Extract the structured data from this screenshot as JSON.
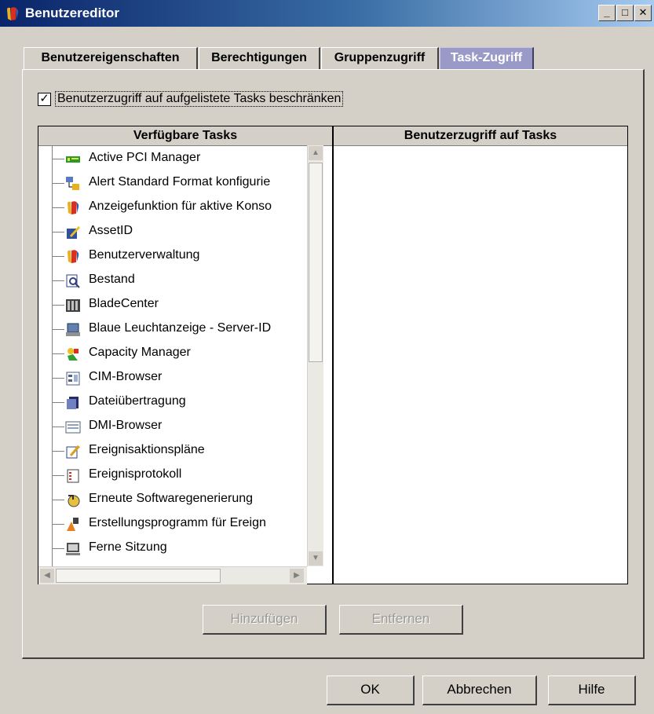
{
  "window": {
    "title": "Benutzereditor",
    "controls": {
      "minimize": "_",
      "maximize": "□",
      "close": "✕"
    }
  },
  "tabs": [
    {
      "label": "Benutzereigenschaften",
      "active": false
    },
    {
      "label": "Berechtigungen",
      "active": false
    },
    {
      "label": "Gruppenzugriff",
      "active": false
    },
    {
      "label": "Task-Zugriff",
      "active": true
    }
  ],
  "restrict": {
    "label": "Benutzerzugriff auf aufgelistete Tasks beschränken",
    "checked": true,
    "mark": "✓"
  },
  "available": {
    "header": "Verfügbare Tasks",
    "items": [
      {
        "label": "Active PCI Manager",
        "icon": "pci-card-icon"
      },
      {
        "label": "Alert Standard Format konfigurie",
        "icon": "alert-network-icon"
      },
      {
        "label": "Anzeigefunktion für aktive Konso",
        "icon": "console-viewer-icon"
      },
      {
        "label": "AssetID",
        "icon": "asset-notepad-icon"
      },
      {
        "label": "Benutzerverwaltung",
        "icon": "user-admin-icon"
      },
      {
        "label": "Bestand",
        "icon": "inventory-magnifier-icon"
      },
      {
        "label": "BladeCenter",
        "icon": "bladecenter-icon"
      },
      {
        "label": "Blaue Leuchtanzeige - Server-ID",
        "icon": "server-led-icon"
      },
      {
        "label": "Capacity Manager",
        "icon": "capacity-manager-icon"
      },
      {
        "label": "CIM-Browser",
        "icon": "cim-browser-icon"
      },
      {
        "label": "Dateiübertragung",
        "icon": "file-transfer-icon"
      },
      {
        "label": "DMI-Browser",
        "icon": "dmi-browser-icon"
      },
      {
        "label": "Ereignisaktionspläne",
        "icon": "event-action-plans-icon"
      },
      {
        "label": "Ereignisprotokoll",
        "icon": "event-log-icon"
      },
      {
        "label": "Erneute Softwaregenerierung",
        "icon": "software-rejuvenation-icon"
      },
      {
        "label": "Erstellungsprogramm für Ereign",
        "icon": "event-builder-icon"
      },
      {
        "label": "Ferne Sitzung",
        "icon": "remote-session-icon"
      }
    ]
  },
  "access": {
    "header": "Benutzerzugriff auf Tasks",
    "items": []
  },
  "buttons": {
    "add": "Hinzufügen",
    "remove": "Entfernen",
    "ok": "OK",
    "cancel": "Abbrechen",
    "help": "Hilfe"
  }
}
